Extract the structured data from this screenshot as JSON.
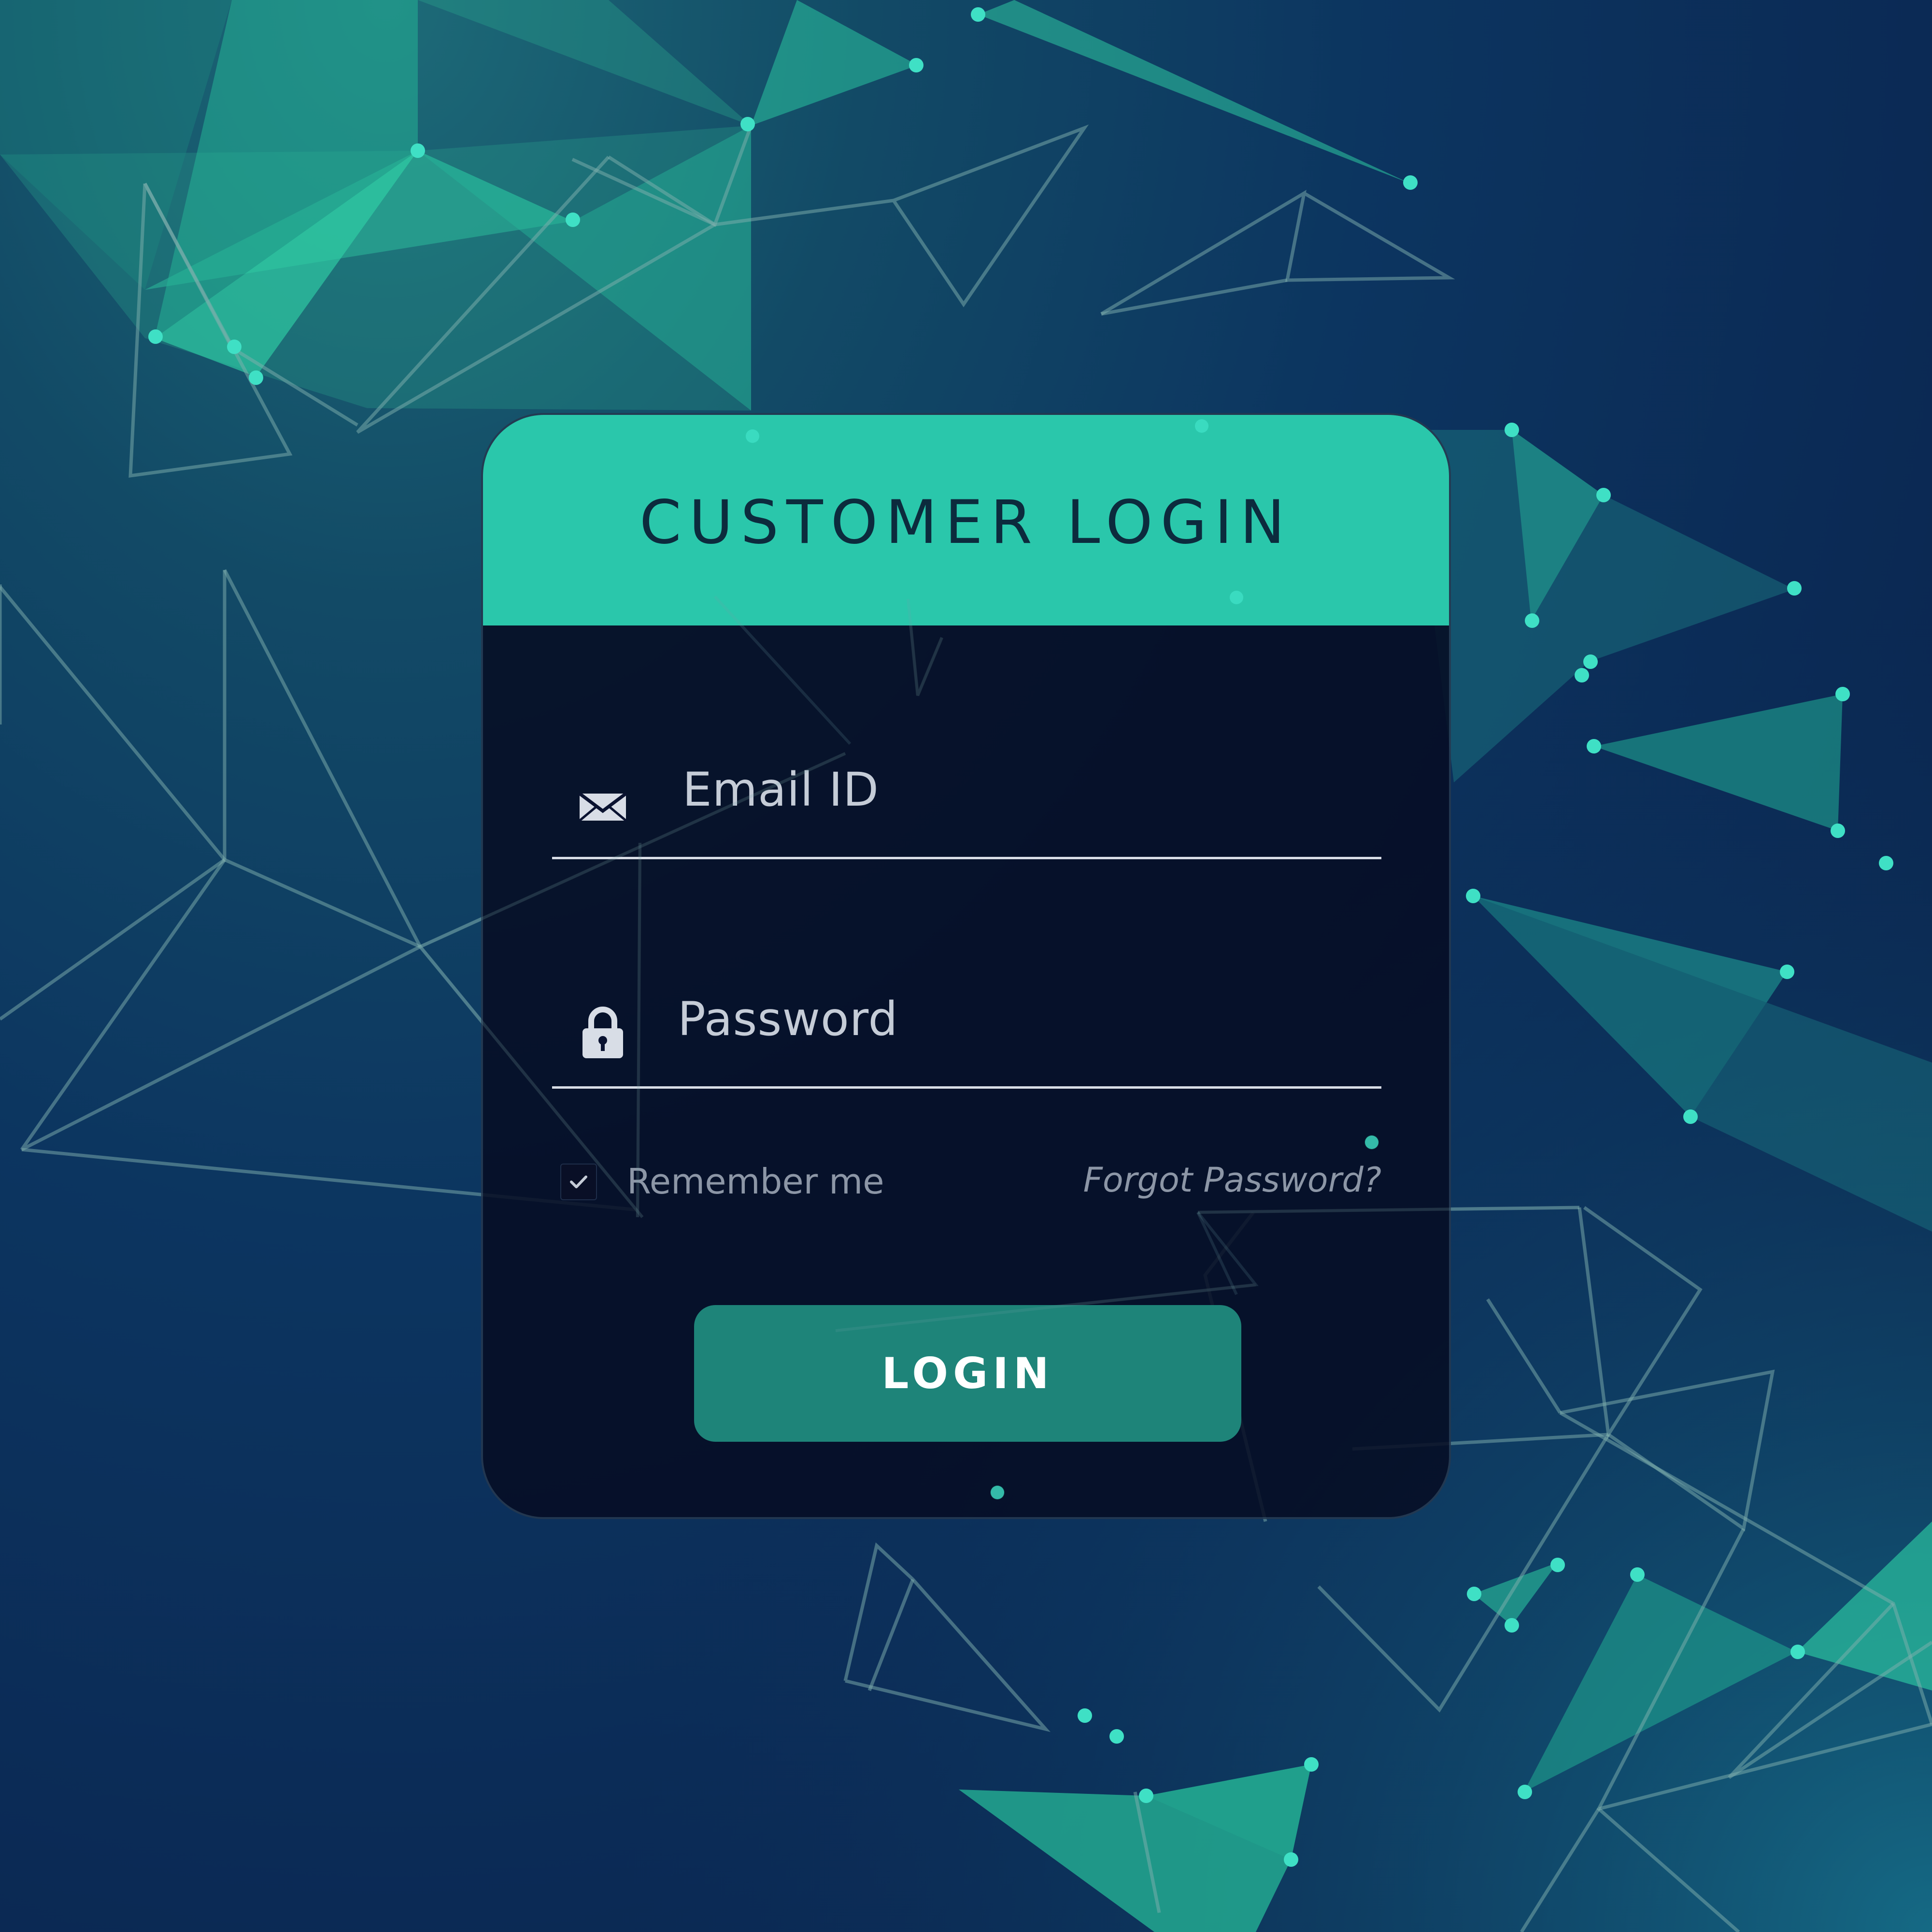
{
  "login_card": {
    "title": "CUSTOMER LOGIN",
    "email_field": {
      "placeholder": "Email ID",
      "icon": "envelope-icon"
    },
    "password_field": {
      "placeholder": "Password",
      "icon": "lock-icon"
    },
    "remember": {
      "label": "Remember me",
      "checked": true
    },
    "forgot_link": "Forgot Password?",
    "login_button": "LOGIN"
  },
  "colors": {
    "accent": "#2dd2b4",
    "button": "#1e8479",
    "card_background": "#060c22",
    "background": "#0b2a55",
    "title_text": "#0c2b3d",
    "field_text": "#c5ccd7",
    "muted_text": "#8c96a6"
  }
}
